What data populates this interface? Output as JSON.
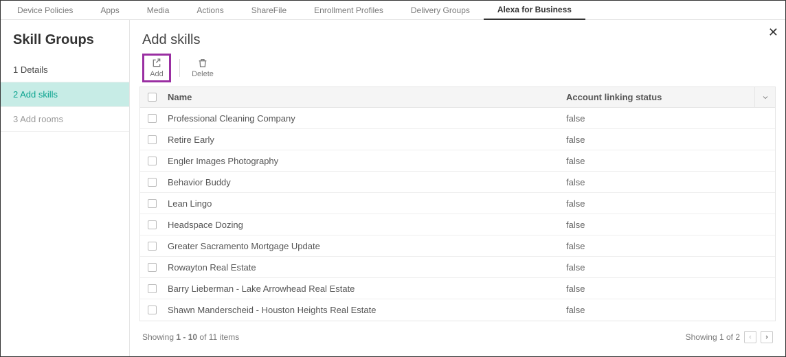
{
  "topnav": {
    "items": [
      "Device Policies",
      "Apps",
      "Media",
      "Actions",
      "ShareFile",
      "Enrollment Profiles",
      "Delivery Groups",
      "Alexa for Business"
    ],
    "activeIndex": 7
  },
  "sidebar": {
    "title": "Skill Groups",
    "steps": [
      {
        "num": "1",
        "label": "Details"
      },
      {
        "num": "2",
        "label": "Add skills"
      },
      {
        "num": "3",
        "label": "Add rooms"
      }
    ],
    "activeIndex": 1
  },
  "main": {
    "title": "Add skills",
    "toolbar": {
      "add_label": "Add",
      "delete_label": "Delete"
    },
    "columns": {
      "name": "Name",
      "status": "Account linking status"
    },
    "rows": [
      {
        "name": "Professional Cleaning Company",
        "status": "false"
      },
      {
        "name": "Retire Early",
        "status": "false"
      },
      {
        "name": "Engler Images Photography",
        "status": "false"
      },
      {
        "name": "Behavior Buddy",
        "status": "false"
      },
      {
        "name": "Lean Lingo",
        "status": "false"
      },
      {
        "name": "Headspace Dozing",
        "status": "false"
      },
      {
        "name": "Greater Sacramento Mortgage Update",
        "status": "false"
      },
      {
        "name": "Rowayton Real Estate",
        "status": "false"
      },
      {
        "name": "Barry Lieberman - Lake Arrowhead Real Estate",
        "status": "false"
      },
      {
        "name": "Shawn Manderscheid - Houston Heights Real Estate",
        "status": "false"
      }
    ],
    "footer": {
      "left_prefix": "Showing ",
      "left_range": "1 - 10",
      "left_middle": " of ",
      "left_total": "11 items",
      "right": "Showing 1 of 2"
    }
  }
}
